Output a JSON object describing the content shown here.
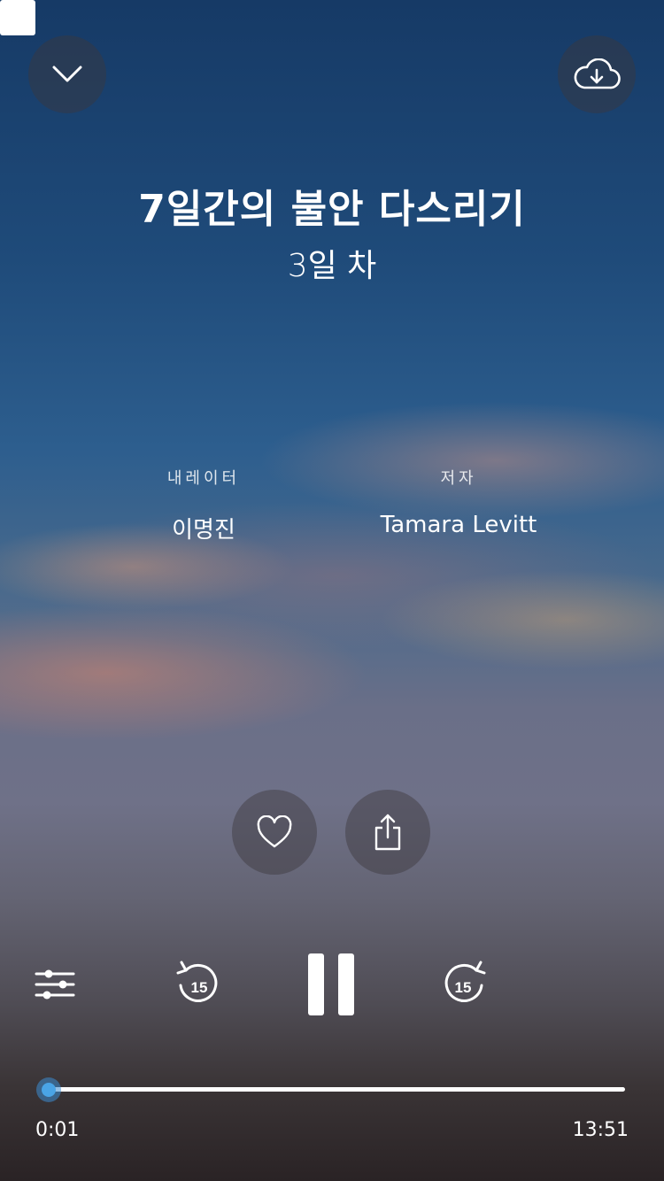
{
  "header": {
    "collapse_icon": "chevron-down-icon",
    "download_icon": "cloud-download-icon"
  },
  "session": {
    "title": "7일간의 불안 다스리기",
    "subtitle": "3일 차"
  },
  "credits": {
    "narrator_label": "내레이터",
    "narrator": "이명진",
    "author_label": "저자",
    "author": "Tamara Levitt"
  },
  "actions": {
    "like_icon": "heart-icon",
    "share_icon": "share-icon"
  },
  "controls": {
    "settings_icon": "sliders-icon",
    "rewind_seconds": "15",
    "forward_seconds": "15",
    "play_state": "playing",
    "stop_icon": "stop-icon"
  },
  "progress": {
    "elapsed": "0:01",
    "duration": "13:51",
    "fraction": 0.001
  },
  "colors": {
    "accent": "#4aa4e6",
    "text": "#ffffff"
  }
}
